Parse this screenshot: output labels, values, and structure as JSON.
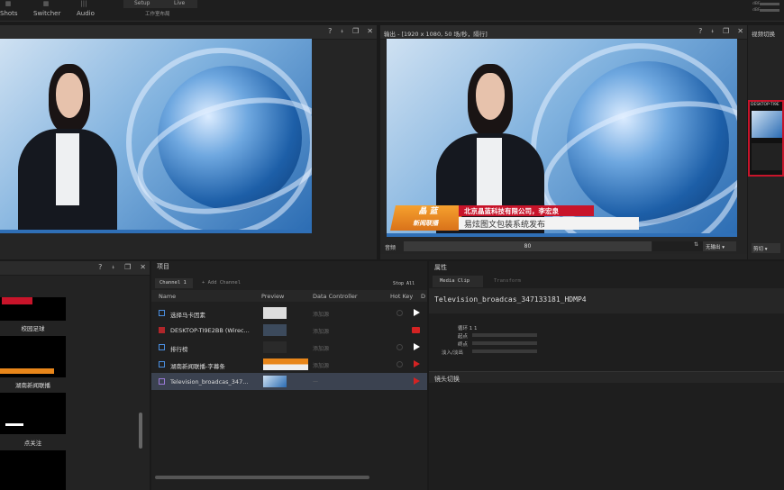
{
  "topbar": {
    "items": [
      "Shots",
      "Switcher",
      "Audio"
    ],
    "setup": "Setup",
    "live": "Live",
    "subtitle": "工作室布局"
  },
  "preview": {
    "icons": [
      "help-icon",
      "pin-icon",
      "float-icon",
      "close-icon"
    ]
  },
  "output": {
    "title": "输出 - [1920 x 1080, 50 场/秒，隔行]",
    "lower_third": {
      "left_top": "晶 蓝",
      "left_bottom": "新闻联播",
      "red_text": "北京晶蓝科技有限公司，李宏泉",
      "white_text": "易炫图文包装系统发布"
    },
    "volume_label": "音频",
    "volume_value": "80",
    "volume_dropdown": "无输出"
  },
  "video_switch": {
    "title": "视频切换",
    "desktop_label": "DESKTOP-TI9E",
    "cut_label": "剪切"
  },
  "library": {
    "items": [
      {
        "caption": "校园足球"
      },
      {
        "caption": "湖南新闻联播"
      },
      {
        "caption": "点关注"
      }
    ]
  },
  "project": {
    "title": "项目",
    "tab": "Channel 1",
    "add_channel": "+ Add Channel",
    "stop_all": "Stop All",
    "columns": [
      "Name",
      "Preview",
      "Data Controller",
      "Hot Key",
      "D"
    ],
    "rows": [
      {
        "name": "选择马卡因素",
        "dc": "添加源",
        "icon": "gfx",
        "action": "play"
      },
      {
        "name": "DESKTOP-TI9E2BB (Wirec...",
        "dc": "添加源",
        "icon": "cam",
        "action": "cam"
      },
      {
        "name": "排行榜",
        "dc": "添加源",
        "icon": "gfx",
        "action": "play"
      },
      {
        "name": "湖南新闻联播-字幕条",
        "dc": "添加源",
        "icon": "gfx",
        "action": "cam"
      },
      {
        "name": "Television_broadcas_347...",
        "dc": "—",
        "icon": "clip",
        "action": "cam"
      }
    ]
  },
  "properties": {
    "title": "属性",
    "tabs": [
      "Media Clip",
      "Transform"
    ],
    "filename": "Television_broadcas_347133181_HDMP4",
    "fields": [
      "循环 1 1",
      "起点",
      "终点",
      "淡入/淡出"
    ],
    "section": "镜头切换"
  },
  "colors": {
    "accent_red": "#c8142a",
    "accent_orange": "#f6a12e",
    "panel_bg": "#252525"
  }
}
